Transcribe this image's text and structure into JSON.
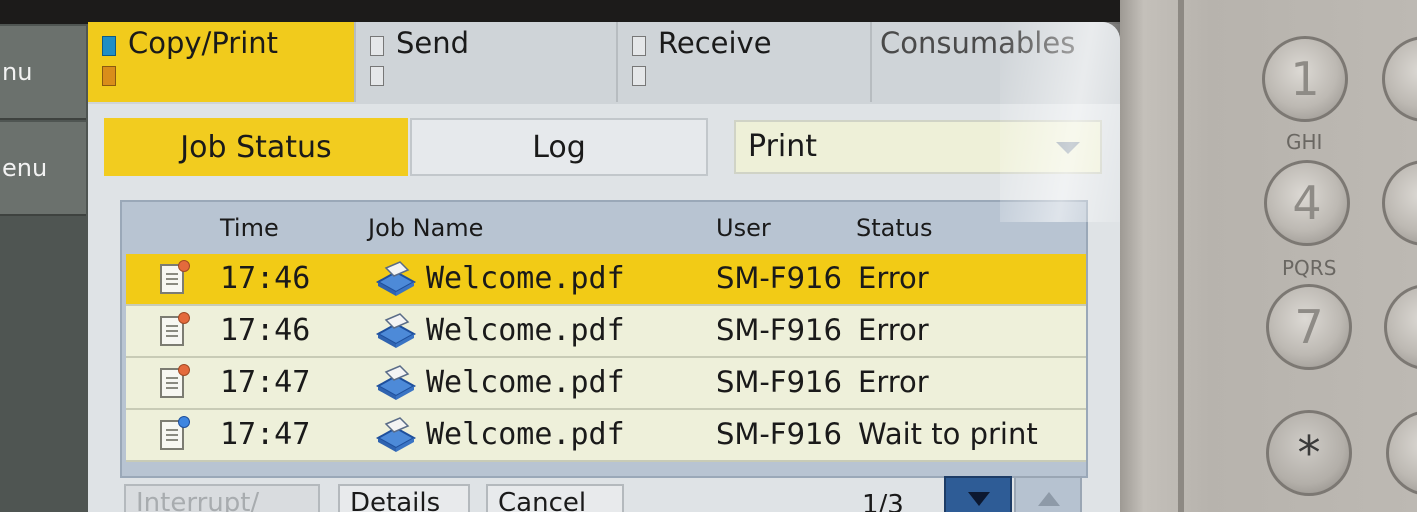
{
  "left_menu": [
    {
      "label": "nu"
    },
    {
      "label": "enu"
    }
  ],
  "top_tabs": [
    {
      "label": "Copy/Print",
      "active": true
    },
    {
      "label": "Send",
      "active": false
    },
    {
      "label": "Receive",
      "active": false
    },
    {
      "label": "Consumables",
      "active": false
    }
  ],
  "sub_tabs": {
    "job_status": "Job Status",
    "log": "Log",
    "filter_value": "Print"
  },
  "table": {
    "headers": {
      "time": "Time",
      "job_name": "Job Name",
      "user": "User",
      "status": "Status"
    },
    "rows": [
      {
        "time": "17:46",
        "job_name": "Welcome.pdf",
        "user": "SM-F916",
        "status": "Error",
        "selected": true,
        "icon": "doc-error-icon"
      },
      {
        "time": "17:46",
        "job_name": "Welcome.pdf",
        "user": "SM-F916",
        "status": "Error",
        "selected": false,
        "icon": "doc-error-icon"
      },
      {
        "time": "17:47",
        "job_name": "Welcome.pdf",
        "user": "SM-F916",
        "status": "Error",
        "selected": false,
        "icon": "doc-error-icon"
      },
      {
        "time": "17:47",
        "job_name": "Welcome.pdf",
        "user": "SM-F916",
        "status": "Wait to print",
        "selected": false,
        "icon": "doc-waiting-icon"
      }
    ]
  },
  "bottom": {
    "interrupt_label": "Interrupt/",
    "details_label": "Details",
    "cancel_label": "Cancel",
    "page_indicator": "1/3"
  },
  "keypad": [
    {
      "key": "1",
      "letters": ""
    },
    {
      "key": "4",
      "letters": "GHI"
    },
    {
      "key": "7",
      "letters": "PQRS"
    },
    {
      "key": "*",
      "letters": ""
    }
  ],
  "colors": {
    "accent_yellow": "#f2cb16",
    "row_bg": "#eef0da",
    "list_frame": "#b8c4d2",
    "nav_blue": "#2e5c96"
  }
}
